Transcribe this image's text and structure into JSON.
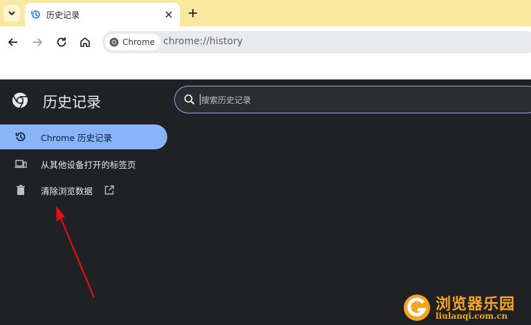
{
  "tab": {
    "title": "历史记录"
  },
  "toolbar": {
    "chip_label": "Chrome",
    "url": "chrome://history"
  },
  "page": {
    "title": "历史记录",
    "search_placeholder": "搜索历史记录"
  },
  "nav": {
    "items": [
      {
        "label": "Chrome 历史记录",
        "icon": "history-icon",
        "selected": true
      },
      {
        "label": "从其他设备打开的标签页",
        "icon": "devices-icon",
        "selected": false
      },
      {
        "label": "清除浏览数据",
        "icon": "trash-icon",
        "selected": false,
        "external": true
      }
    ]
  },
  "colors": {
    "tabstrip": "#f9e8a0",
    "page_bg": "#202124",
    "accent": "#8ab4f8",
    "annotation_arrow": "#e01010",
    "watermark": "#f5a623"
  },
  "watermark": {
    "title": "浏览器乐园",
    "url": "liulanqi.com.cn"
  }
}
